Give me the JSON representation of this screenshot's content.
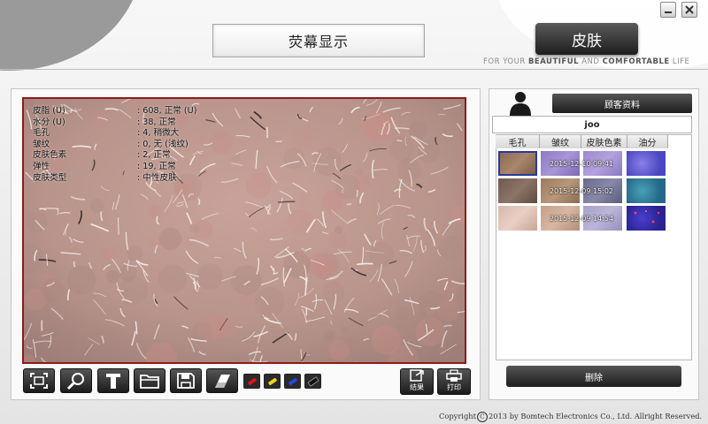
{
  "header": {
    "screen_title": "荧幕显示",
    "brand_button": "皮肤",
    "tagline_pre": "FOR YOUR ",
    "tagline_b1": "BEAUTIFUL",
    "tagline_mid": " AND ",
    "tagline_b2": "COMFORTABLE",
    "tagline_post": " LIFE",
    "minimize_icon": "minimize-icon",
    "close_icon": "close-icon"
  },
  "readout": [
    {
      "label": "皮脂 (U)",
      "value": ": 608, 正常 (U)"
    },
    {
      "label": "水分 (U)",
      "value": ": 38, 正常"
    },
    {
      "label": "毛孔",
      "value": ": 4, 稍微大"
    },
    {
      "label": "皱纹",
      "value": ": 0, 无 (浅纹)"
    },
    {
      "label": "皮肤色素",
      "value": ": 2, 正常"
    },
    {
      "label": "弹性",
      "value": ": 19, 正常"
    },
    {
      "label": "皮肤类型",
      "value": ": 中性皮肤"
    }
  ],
  "toolbar": {
    "tools": [
      "fit-screen-icon",
      "zoom-icon",
      "text-icon",
      "folder-icon",
      "save-icon",
      "eraser-icon"
    ],
    "pen_colors": [
      "#e0141c",
      "#f2d21a",
      "#2446e0",
      "#111111"
    ],
    "result_label": "结果",
    "print_label": "打印"
  },
  "customer": {
    "button_label": "顾客资料",
    "name": "joo",
    "columns": [
      "毛孔",
      "皱纹",
      "皮肤色素",
      "油分"
    ],
    "records": [
      {
        "date": "2015-12-10 09:41"
      },
      {
        "date": "2015-12-09 15:02"
      },
      {
        "date": "2015-12-09 14:54"
      }
    ],
    "delete_label": "删除"
  },
  "footer": {
    "copyright_pre": "Copyright",
    "copyright_symbol": "C",
    "copyright_post": "2013 by Bomtech Electronics Co., Ltd. Allright Reserved."
  }
}
